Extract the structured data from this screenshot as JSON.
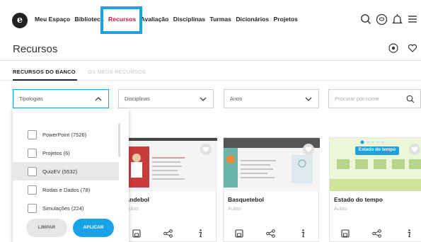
{
  "nav": {
    "logo": "e",
    "links": [
      "Meu Espaço",
      "Biblioteca",
      "Recursos",
      "Avaliação",
      "Disciplinas",
      "Turmas",
      "Dicionários",
      "Projetos"
    ],
    "active": "Recursos",
    "icons": [
      "search-icon",
      "chat-icon",
      "bell-icon",
      "menu-icon"
    ]
  },
  "header": {
    "title": "Recursos",
    "icons": [
      "location-icon",
      "heart-icon"
    ]
  },
  "tabs": [
    "RECURSOS DO BANCO",
    "OS MEUS RECURSOS"
  ],
  "filters": {
    "tipologias": "Tipologias",
    "disciplinas": "Disciplinas",
    "anos": "Anos",
    "search_placeholder": "Procurar por nome"
  },
  "dropdown": {
    "items": [
      {
        "label": "PowerPoint (7526)",
        "checked": false
      },
      {
        "label": "Projetos (6)",
        "checked": false
      },
      {
        "label": "QuizEV (5532)",
        "checked": false,
        "highlighted": true
      },
      {
        "label": "Rodas e Dados (78)",
        "checked": false
      },
      {
        "label": "Simulações (224)",
        "checked": false
      }
    ],
    "clear_label": "LIMPAR",
    "apply_label": "APLICAR"
  },
  "cards": [
    {
      "title": "Andebol",
      "subtitle": "Aulas",
      "thumb_label": "Andebol"
    },
    {
      "title": "Basquetebol",
      "subtitle": "Aulas",
      "thumb_label": "Basquetebol"
    },
    {
      "title": "Estado do tempo",
      "subtitle": "Aulas",
      "thumb_label": "Estado do tempo"
    }
  ],
  "colors": {
    "accent": "#19a3e6",
    "active_nav": "#d8163c"
  }
}
